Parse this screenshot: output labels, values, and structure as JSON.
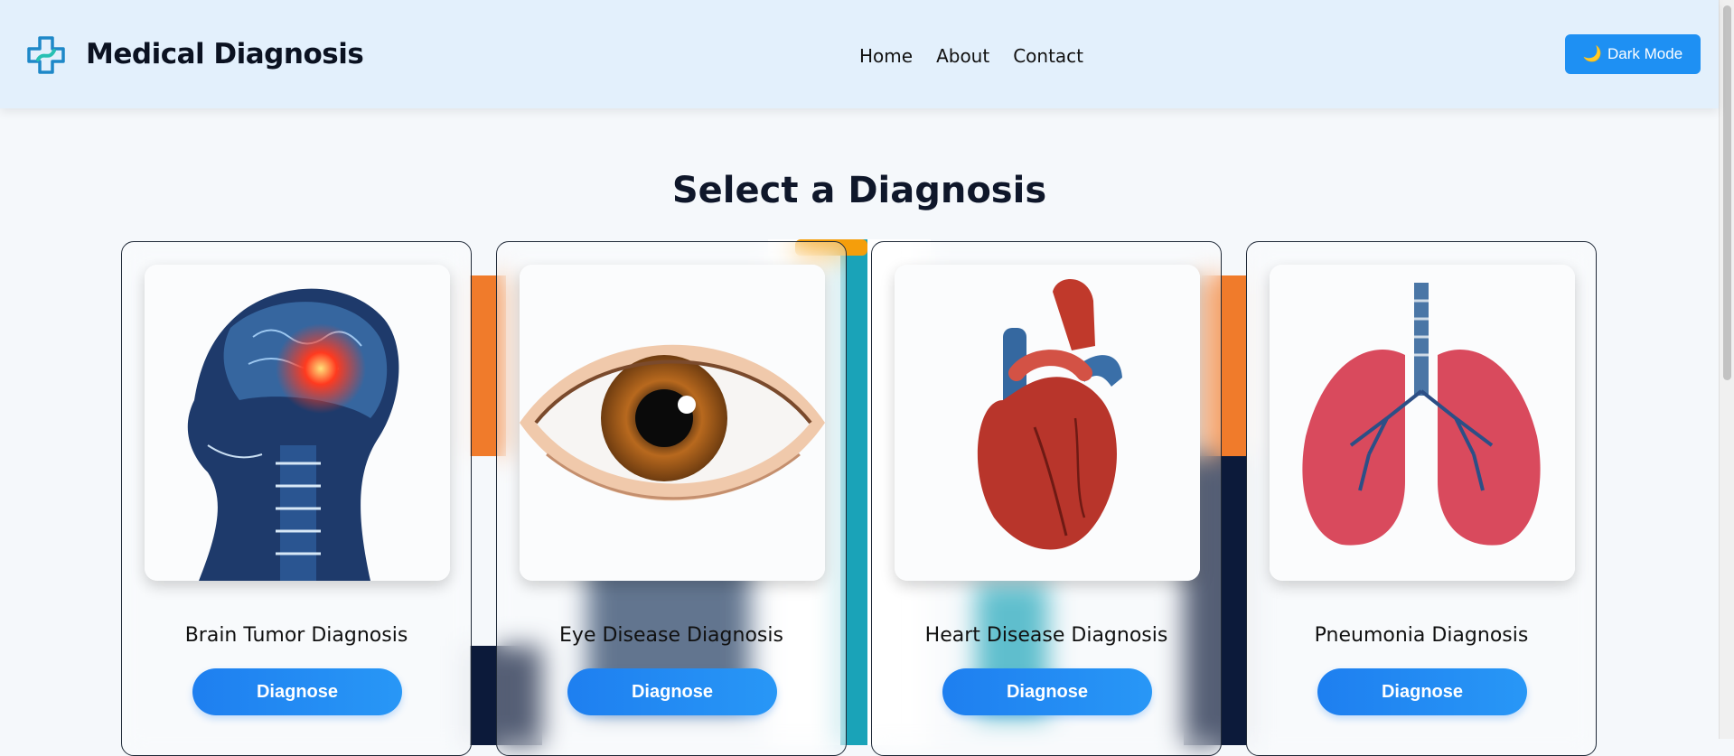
{
  "header": {
    "brand": "Medical Diagnosis",
    "nav": [
      "Home",
      "About",
      "Contact"
    ],
    "dark_mode_icon": "🌙",
    "dark_mode_label": "Dark Mode"
  },
  "main": {
    "title": "Select a Diagnosis",
    "cards": [
      {
        "title": "Brain Tumor Diagnosis",
        "button": "Diagnose",
        "image": "brain-xray-illustration"
      },
      {
        "title": "Eye Disease Diagnosis",
        "button": "Diagnose",
        "image": "eye-illustration"
      },
      {
        "title": "Heart Disease Diagnosis",
        "button": "Diagnose",
        "image": "heart-illustration"
      },
      {
        "title": "Pneumonia Diagnosis",
        "button": "Diagnose",
        "image": "lungs-illustration"
      }
    ]
  },
  "colors": {
    "header_bg": "#e3f0fc",
    "accent": "#1e90f3",
    "page_bg": "#f5f8fb"
  }
}
